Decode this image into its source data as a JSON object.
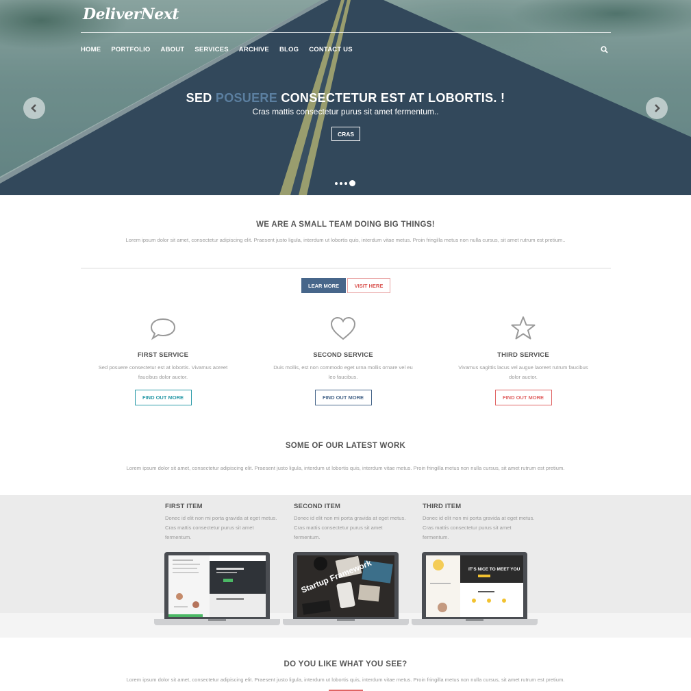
{
  "brand": {
    "logo": "DeliverNext"
  },
  "nav": {
    "items": [
      "HOME",
      "PORTFOLIO",
      "ABOUT",
      "SERVICES",
      "ARCHIVE",
      "BLOG",
      "CONTACT US"
    ]
  },
  "hero": {
    "title_part1": "SED ",
    "title_accent": "POSUERE",
    "title_part2": " CONSECTETUR EST AT LOBORTIS. !",
    "subtitle": "Cras mattis consectetur purus sit amet fermentum..",
    "button": "CRAS",
    "slides": 4,
    "active_slide": 4
  },
  "about": {
    "title": "WE ARE A SMALL TEAM DOING BIG THINGS!",
    "text": "Lorem ipsum dolor sit amet, consectetur adipiscing elit. Praesent justo ligula, interdum ut lobortis quis, interdum vitae metus. Proin fringilla metus non nulla cursus, sit amet rutrum est pretium..",
    "btn_primary": "LEAR MORE",
    "btn_secondary": "VISIT HERE"
  },
  "services": [
    {
      "icon": "speech-bubble-icon",
      "title": "FIRST SERVICE",
      "text": "Sed posuere consectetur est at lobortis. Vivamus aoreet faucibus dolor auctor.",
      "button": "FIND OUT MORE",
      "color": "#2a9aa8"
    },
    {
      "icon": "heart-icon",
      "title": "SECOND SERVICE",
      "text": "Duis mollis, est non commodo eget urna mollis ornare vel eu leo faucibus.",
      "button": "FIND OUT MORE",
      "color": "#47668a"
    },
    {
      "icon": "star-icon",
      "title": "THIRD SERVICE",
      "text": "Vivamus sagittis lacus vel augue laoreet rutrum faucibus dolor auctor.",
      "button": "FIND OUT MORE",
      "color": "#e06464"
    }
  ],
  "work": {
    "title": "SOME OF OUR LATEST WORK",
    "text": "Lorem ipsum dolor sit amet, consectetur adipiscing elit. Praesent justo ligula, interdum ut lobortis quis, interdum vitae metus. Proin fringilla metus non nulla cursus, sit amet rutrum est pretium.",
    "items": [
      {
        "title": "FIRST ITEM",
        "text": "Donec id elit non mi porta gravida at eget metus. Cras mattis consectetur purus sit amet fermentum."
      },
      {
        "title": "SECOND ITEM",
        "text": "Donec id elit non mi porta gravida at eget metus. Cras mattis consectetur purus sit amet fermentum.",
        "screen_text": "Startup Framework"
      },
      {
        "title": "THIRD ITEM",
        "text": "Donec id elit non mi porta gravida at eget metus. Cras mattis consectetur purus sit amet fermentum.",
        "screen_text": "IT'S NICE TO MEET YOU"
      }
    ]
  },
  "cta": {
    "title": "DO YOU LIKE WHAT YOU SEE?",
    "text": "Lorem ipsum dolor sit amet, consectetur adipiscing elit. Praesent justo ligula, interdum ut lobortis quis, interdum vitae metus. Proin fringilla metus non nulla cursus, sit amet rutrum est pretium."
  },
  "colors": {
    "accent_blue": "#47668a",
    "accent_teal": "#2a9aa8",
    "accent_red": "#e06464"
  }
}
